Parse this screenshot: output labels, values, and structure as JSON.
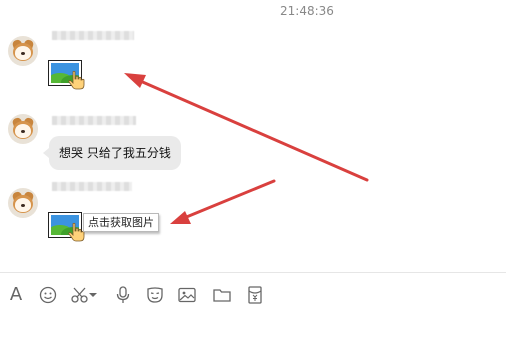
{
  "chat": {
    "timestamp": "21:48:36",
    "messages": [
      {
        "type": "image",
        "hint": ""
      },
      {
        "type": "text",
        "text": "想哭 只给了我五分钱"
      },
      {
        "type": "image",
        "hint": "点击获取图片"
      }
    ]
  },
  "colors": {
    "annotation_arrow": "#d9403e",
    "bubble_bg": "#eaeaea",
    "toolbar_icon": "#666666"
  },
  "toolbar": {
    "icons": [
      "font-icon",
      "emoji-icon",
      "scissors-icon",
      "dropdown-caret-icon",
      "microphone-icon",
      "mask-icon",
      "image-icon",
      "folder-icon",
      "red-packet-icon"
    ]
  }
}
